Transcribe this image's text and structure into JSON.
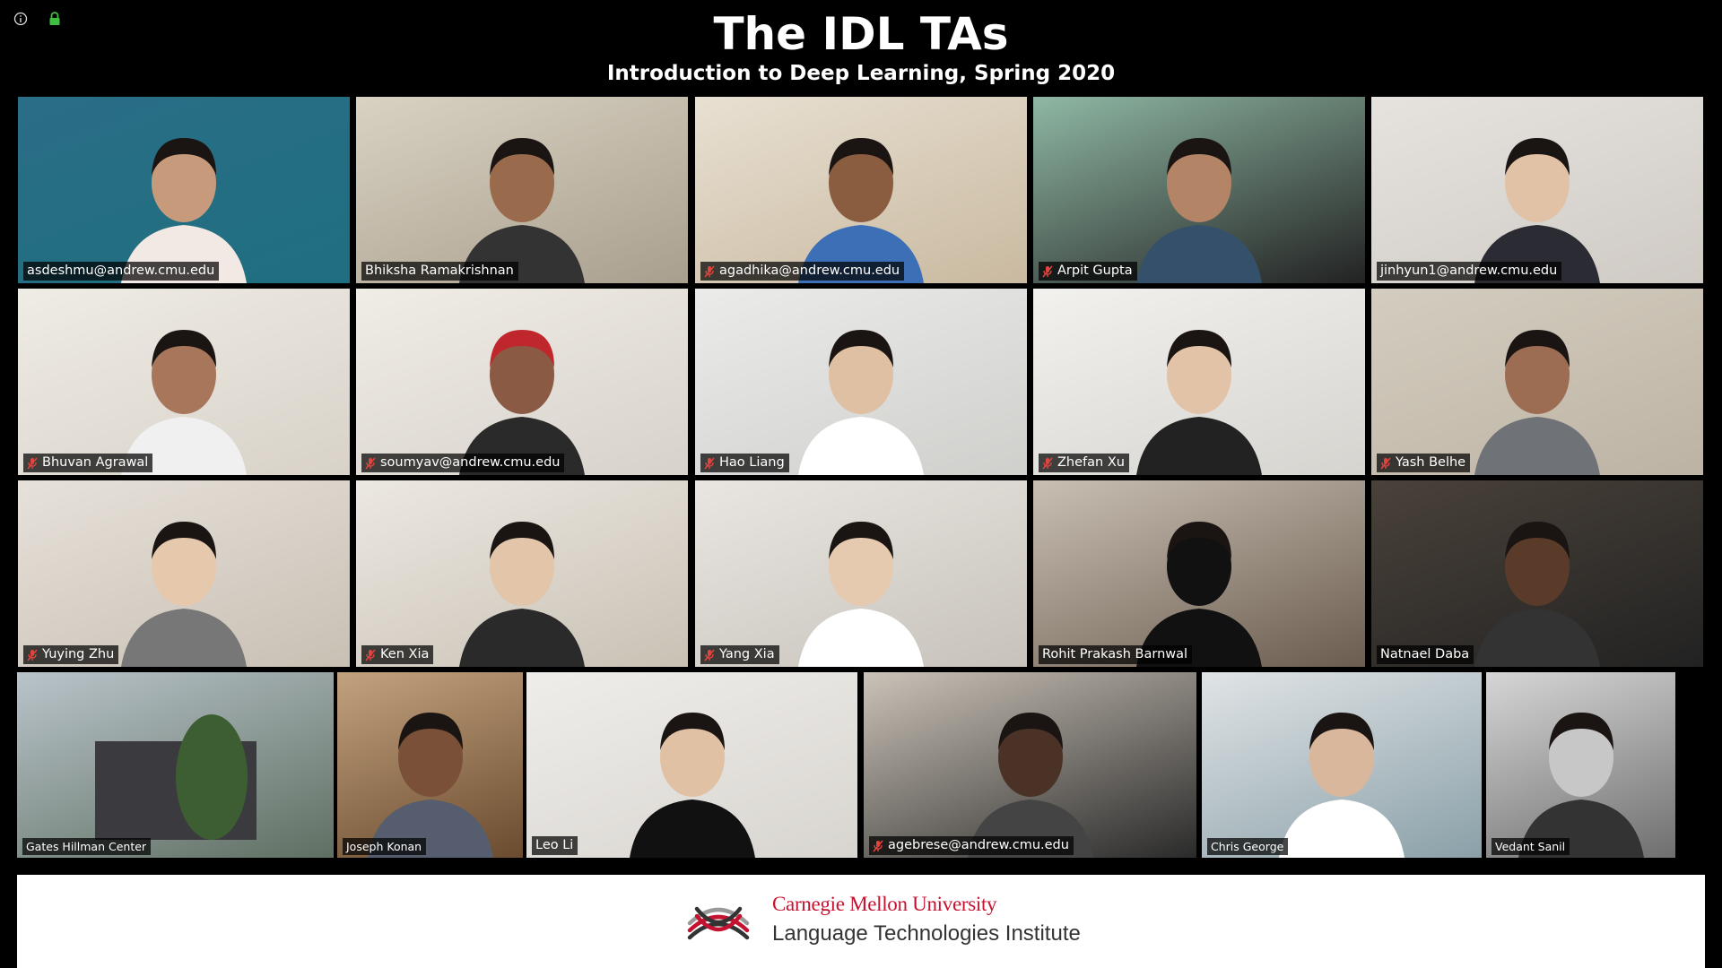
{
  "window": {
    "icons": [
      "info-icon",
      "lock-icon"
    ]
  },
  "header": {
    "title": "The IDL TAs",
    "subtitle": "Introduction to Deep Learning, Spring 2020"
  },
  "participants": [
    {
      "name": "asdeshmu@andrew.cmu.edu",
      "muted": false,
      "active": false
    },
    {
      "name": "Bhiksha Ramakrishnan",
      "muted": false,
      "active": true
    },
    {
      "name": "agadhika@andrew.cmu.edu",
      "muted": true,
      "active": false
    },
    {
      "name": "Arpit Gupta",
      "muted": true,
      "active": false
    },
    {
      "name": "jinhyun1@andrew.cmu.edu",
      "muted": false,
      "active": false
    },
    {
      "name": "Bhuvan Agrawal",
      "muted": true,
      "active": false
    },
    {
      "name": "soumyav@andrew.cmu.edu",
      "muted": true,
      "active": false
    },
    {
      "name": "Hao Liang",
      "muted": true,
      "active": false
    },
    {
      "name": "Zhefan Xu",
      "muted": true,
      "active": false
    },
    {
      "name": "Yash Belhe",
      "muted": true,
      "active": false
    },
    {
      "name": "Yuying Zhu",
      "muted": true,
      "active": false
    },
    {
      "name": "Ken Xia",
      "muted": true,
      "active": false
    },
    {
      "name": "Yang Xia",
      "muted": true,
      "active": false
    },
    {
      "name": "Rohit Prakash Barnwal",
      "muted": false,
      "active": false
    },
    {
      "name": "Natnael Daba",
      "muted": false,
      "active": false
    },
    {
      "name": "Gates Hillman Center",
      "muted": false,
      "active": false
    },
    {
      "name": "Joseph Konan",
      "muted": false,
      "active": false
    },
    {
      "name": "Leo Li",
      "muted": false,
      "active": false
    },
    {
      "name": "agebrese@andrew.cmu.edu",
      "muted": true,
      "active": false
    },
    {
      "name": "Chris George",
      "muted": false,
      "active": false
    },
    {
      "name": "Vedant Sanil",
      "muted": false,
      "active": false
    }
  ],
  "footer": {
    "university": "Carnegie Mellon University",
    "institute": "Language Technologies Institute"
  },
  "colors": {
    "active_speaker_border": "#d9e36b",
    "muted_icon": "#e0443e",
    "cmu_red": "#c41230"
  }
}
